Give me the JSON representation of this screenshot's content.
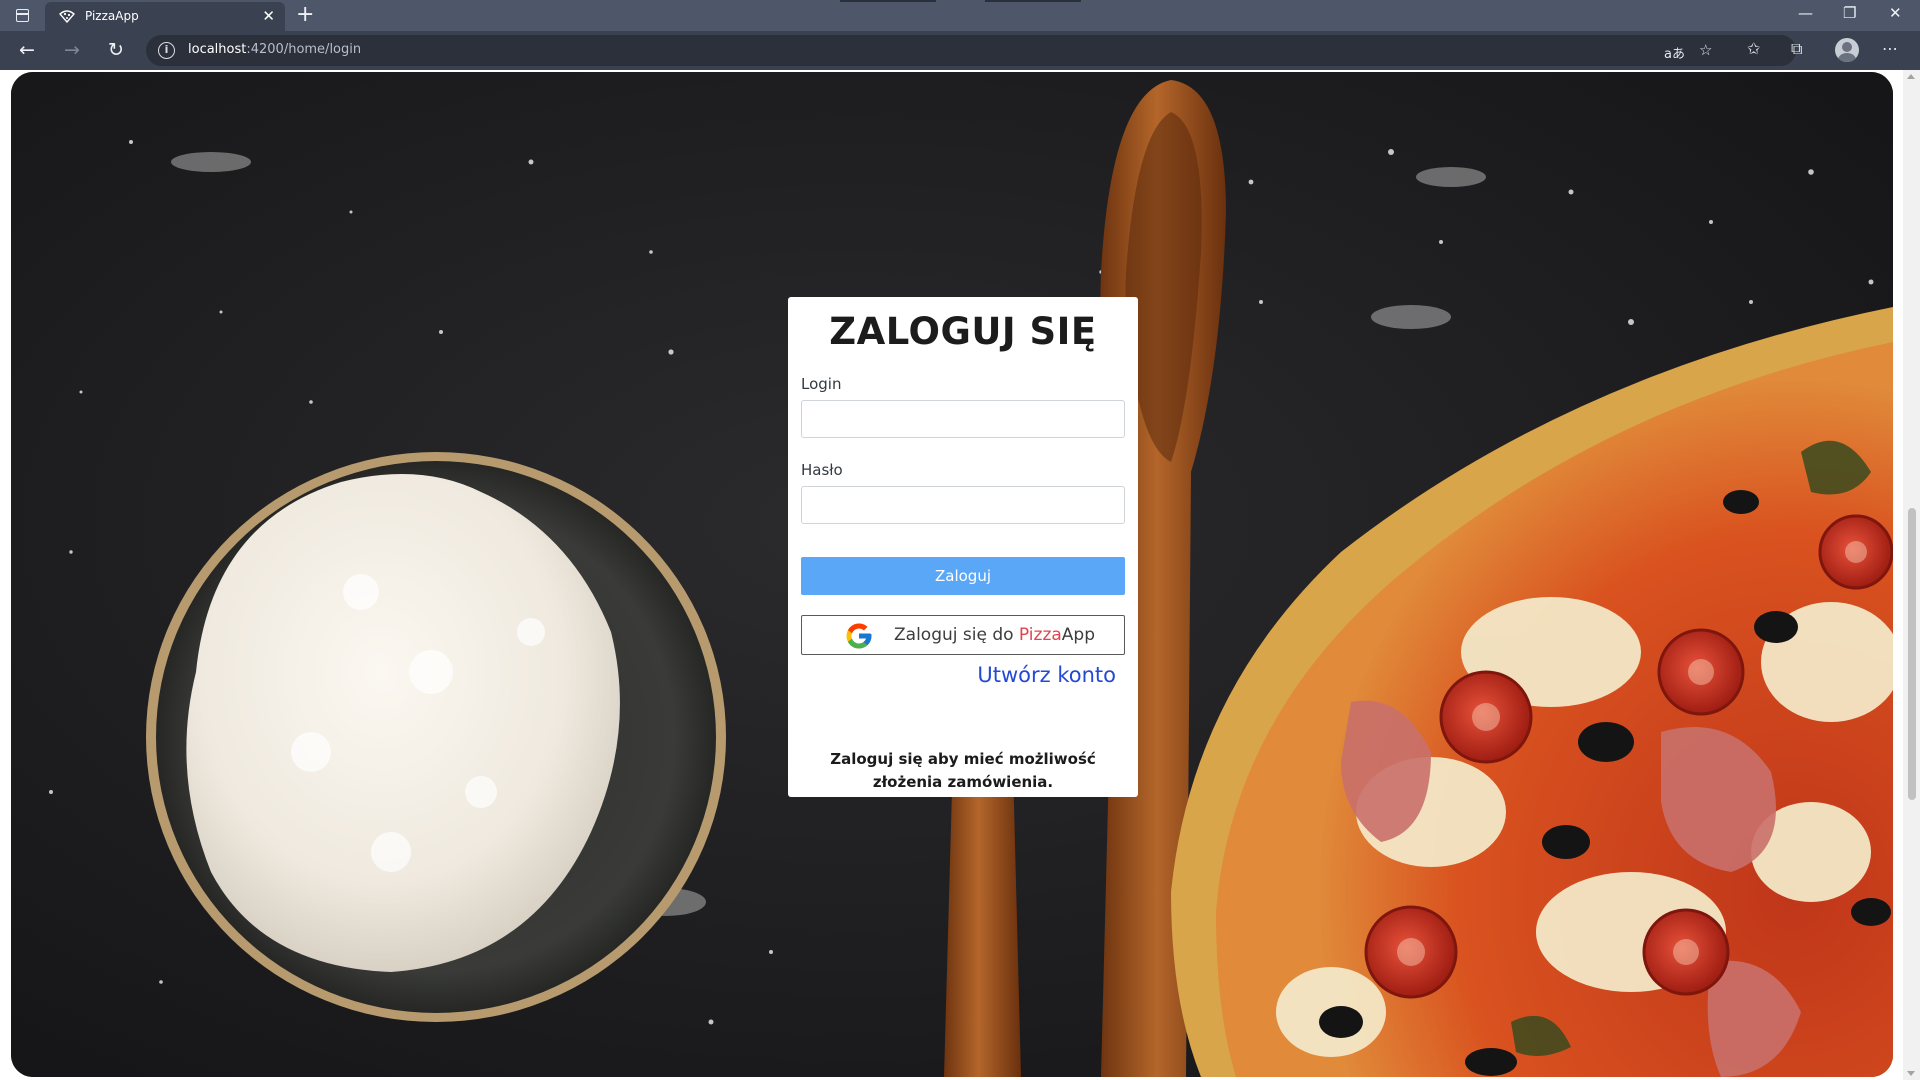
{
  "browser": {
    "tab_title": "PizzaApp",
    "tab_close": "✕",
    "new_tab": "+",
    "url_host": "localhost",
    "url_path": ":4200/home/login",
    "window_minimize": "—",
    "window_restore": "❐",
    "window_close": "✕",
    "back": "←",
    "forward": "→",
    "reload": "↻",
    "read_aloud": "aあ",
    "more": "⋯"
  },
  "login": {
    "title": "ZALOGUJ SIĘ",
    "login_label": "Login",
    "login_value": "",
    "password_label": "Hasło",
    "password_value": "",
    "submit_label": "Zaloguj",
    "google_prefix": "Zaloguj się do ",
    "google_brand_part1": "Pizza",
    "google_brand_part2": "App",
    "create_account_label": "Utwórz konto",
    "note": "Zaloguj się aby mieć możliwość złożenia zamówienia."
  },
  "colors": {
    "submit_button": "#5aa7f7",
    "link": "#2349d6",
    "brand_accent": "#e2424d",
    "browser_frame": "#3a4150"
  }
}
